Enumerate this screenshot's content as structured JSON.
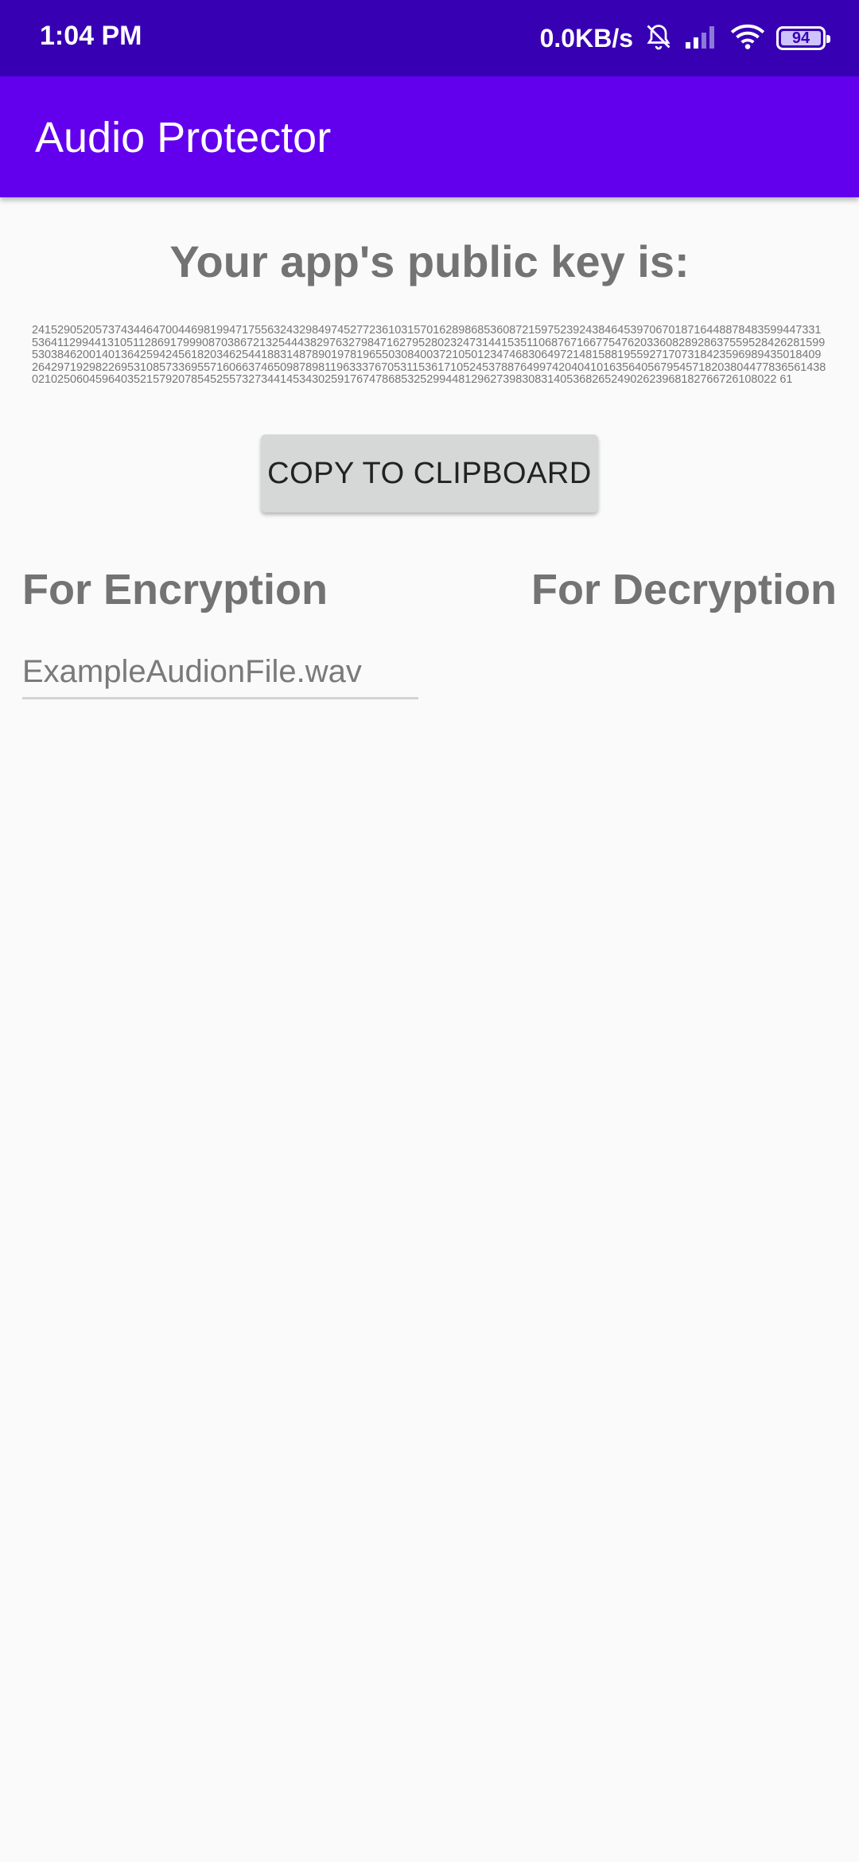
{
  "status_bar": {
    "time": "1:04 PM",
    "net_speed": "0.0KB/s",
    "battery_level": "94",
    "icons": [
      "bell-off-icon",
      "signal-icon",
      "wifi-icon",
      "battery-icon"
    ]
  },
  "app_bar": {
    "title": "Audio Protector",
    "color": "#6200ee"
  },
  "main": {
    "key_heading": "Your app's public key is:",
    "public_key": "241529052057374344647004469819947175563243298497452772361031570162898685360872159752392438464539706701871644887848359944733153641129944131051128691799908703867213254443829763279847162795280232473144153511068767166775476203360828928637559528426281599530384620014013642594245618203462544188314878901978196550308400372105012347468306497214815881955927170731842359698943501840926429719298226953108573369557160663746509878981196333767053115361710524537887649974204041016356405679545718203804477836561438021025060459640352157920785452557327344145343025917674786853252994481296273983083140536826524902623968182766726108022 61",
    "copy_button": "COPY TO CLIPBOARD",
    "encryption_heading": "For Encryption",
    "decryption_heading": "For Decryption",
    "file_field_value": "ExampleAudionFile.wav"
  }
}
